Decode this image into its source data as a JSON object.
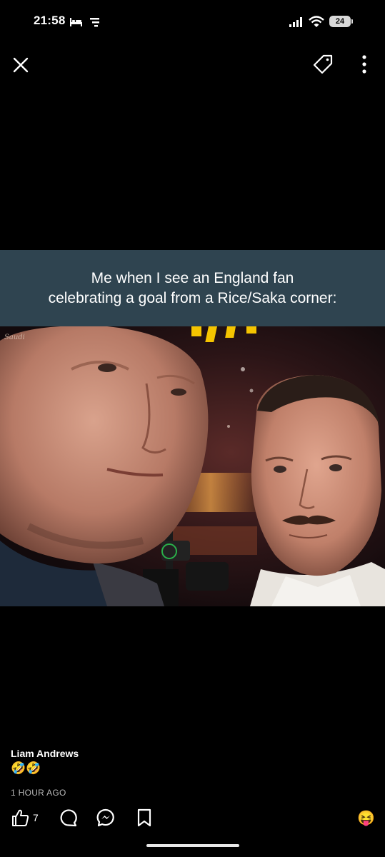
{
  "status_bar": {
    "time": "21:58",
    "battery": "24",
    "left_icons": [
      "sleep-icon",
      "sim-icon"
    ],
    "right_icons": [
      "signal-icon",
      "wifi-icon",
      "battery-icon"
    ]
  },
  "top_bar": {
    "close_icon": "close-icon",
    "tag_icon": "tag-icon",
    "more_icon": "more-vertical-icon"
  },
  "meme": {
    "caption_line1": "Me when I see an England fan",
    "caption_line2": "celebrating a goal from a Rice/Saka corner:",
    "caption_bg": "#2f4450"
  },
  "post": {
    "author": "Liam Andrews",
    "comment_emojis": "🤣🤣",
    "timestamp": "1 HOUR AGO"
  },
  "actions": {
    "like_count": "7",
    "like_icon": "thumbs-up-icon",
    "comment_icon": "comment-icon",
    "messenger_icon": "messenger-icon",
    "save_icon": "bookmark-icon",
    "reaction_emoji": "😝"
  }
}
